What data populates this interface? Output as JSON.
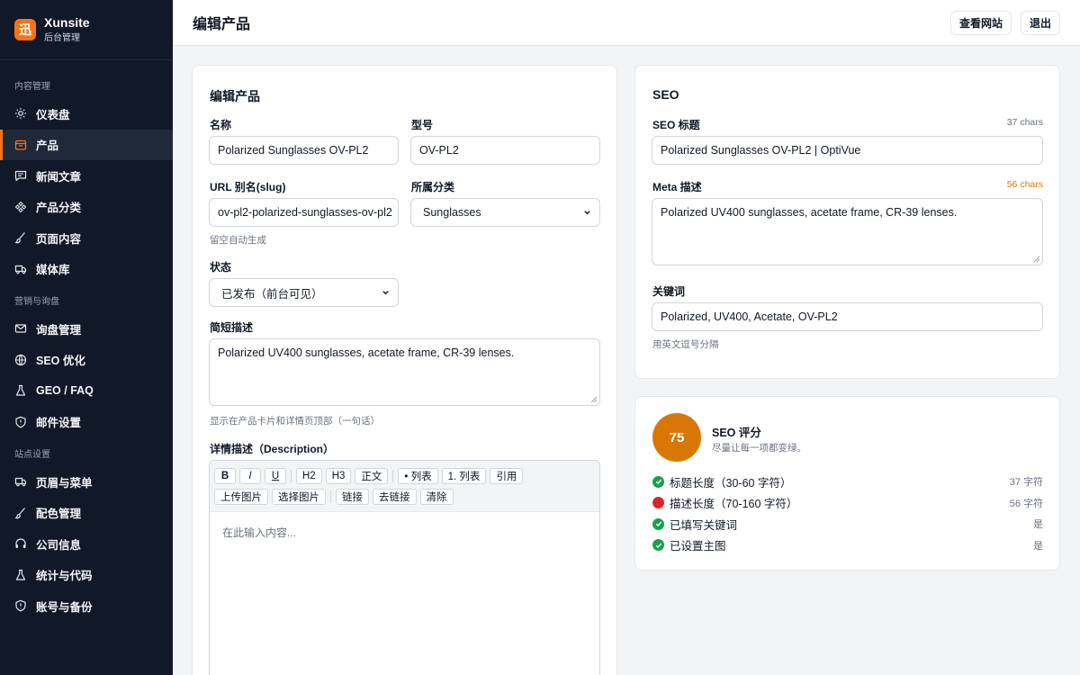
{
  "brand": {
    "logo_char": "迅",
    "name": "Xunsite",
    "sub": "后台管理"
  },
  "sidebar": {
    "sections": [
      {
        "title": "内容管理",
        "items": [
          {
            "label": "仪表盘",
            "icon": "sun-icon"
          },
          {
            "label": "产品",
            "icon": "box-icon",
            "active": true
          },
          {
            "label": "新闻文章",
            "icon": "message-icon"
          },
          {
            "label": "产品分类",
            "icon": "grid-icon"
          },
          {
            "label": "页面内容",
            "icon": "brush-icon"
          },
          {
            "label": "媒体库",
            "icon": "truck-icon"
          }
        ]
      },
      {
        "title": "营销与询盘",
        "items": [
          {
            "label": "询盘管理",
            "icon": "mail-icon"
          },
          {
            "label": "SEO 优化",
            "icon": "globe-icon"
          },
          {
            "label": "GEO / FAQ",
            "icon": "flask-icon"
          },
          {
            "label": "邮件设置",
            "icon": "shield-icon"
          }
        ]
      },
      {
        "title": "站点设置",
        "items": [
          {
            "label": "页眉与菜单",
            "icon": "truck-icon"
          },
          {
            "label": "配色管理",
            "icon": "brush-icon"
          },
          {
            "label": "公司信息",
            "icon": "headphones-icon"
          },
          {
            "label": "统计与代码",
            "icon": "flask-icon"
          },
          {
            "label": "账号与备份",
            "icon": "shield-icon"
          }
        ]
      }
    ]
  },
  "header": {
    "title": "编辑产品",
    "view_site": "查看网站",
    "logout": "退出"
  },
  "form": {
    "title": "编辑产品",
    "name_label": "名称",
    "name_value": "Polarized Sunglasses OV-PL2",
    "model_label": "型号",
    "model_value": "OV-PL2",
    "slug_label": "URL 别名(slug)",
    "slug_value": "ov-pl2-polarized-sunglasses-ov-pl2",
    "slug_hint": "留空自动生成",
    "category_label": "所属分类",
    "category_value": "Sunglasses",
    "status_label": "状态",
    "status_value": "已发布（前台可见）",
    "short_label": "简短描述",
    "short_value": "Polarized UV400 sunglasses, acetate frame, CR-39 lenses.",
    "short_hint": "显示在产品卡片和详情页顶部（一句话）",
    "detail_label": "详情描述（Description）",
    "toolbar_row1": [
      "B",
      "I",
      "U",
      "H2",
      "H3",
      "正文",
      "• 列表",
      "1. 列表",
      "引用"
    ],
    "toolbar_row2": [
      "上传图片",
      "选择图片",
      "链接",
      "去链接",
      "清除"
    ],
    "editor_placeholder": "在此输入内容..."
  },
  "seo": {
    "title": "SEO",
    "seo_title_label": "SEO 标题",
    "seo_title_count": "37 chars",
    "seo_title_value": "Polarized Sunglasses OV-PL2 | OptiVue",
    "meta_label": "Meta 描述",
    "meta_count": "56 chars",
    "meta_value": "Polarized UV400 sunglasses, acetate frame, CR-39 lenses.",
    "keywords_label": "关键词",
    "keywords_value": "Polarized, UV400, Acetate, OV-PL2",
    "keywords_hint": "用英文逗号分隔"
  },
  "score": {
    "value": "75",
    "title": "SEO 评分",
    "subtitle": "尽量让每一项都变绿。",
    "checks": [
      {
        "label": "标题长度（30-60 字符）",
        "value": "37 字符",
        "ok": true
      },
      {
        "label": "描述长度（70-160 字符）",
        "value": "56 字符",
        "ok": false
      },
      {
        "label": "已填写关键词",
        "value": "是",
        "ok": true
      },
      {
        "label": "已设置主图",
        "value": "是",
        "ok": true
      }
    ]
  },
  "colors": {
    "accent": "#f97316",
    "score": "#d97706",
    "ok": "#16a34a",
    "bad": "#dc2626",
    "sidebar": "#111827"
  }
}
